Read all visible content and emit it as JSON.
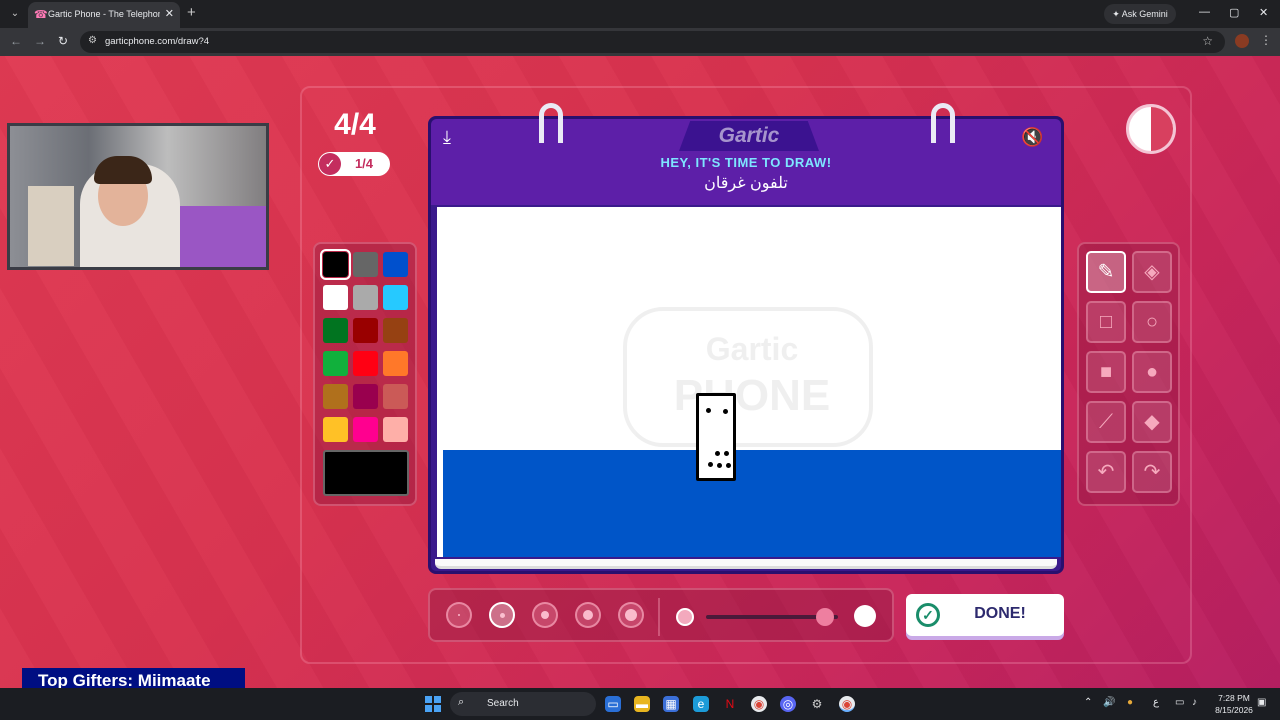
{
  "browser": {
    "tab_title": "Gartic Phone - The Telephone G",
    "tab_close": "✕",
    "new_tab": "+",
    "ask_gemini": "Ask Gemini",
    "url": "garticphone.com/draw?4"
  },
  "game": {
    "round": "4/4",
    "players_done": "1/4",
    "logo": "Gartic",
    "prompt": "HEY, IT'S TIME TO DRAW!",
    "word": "تلفون غرقان",
    "watermark_top": "Gartic",
    "watermark_bottom": "PHONE",
    "done_label": "DONE!",
    "timer_remaining_fraction": 0.5
  },
  "palette": {
    "colors": [
      "#000000",
      "#666666",
      "#0050cd",
      "#ffffff",
      "#aaaaaa",
      "#26c9ff",
      "#017420",
      "#990000",
      "#964112",
      "#11b03c",
      "#ff0013",
      "#ff7829",
      "#b0701c",
      "#99004e",
      "#cb5a57",
      "#ffc126",
      "#ff008f",
      "#feafa8"
    ],
    "selected_index": 0,
    "current_color": "#000000"
  },
  "tools": [
    {
      "name": "pen-tool",
      "icon": "✎"
    },
    {
      "name": "eraser-tool",
      "icon": "◈"
    },
    {
      "name": "rectangle-outline-tool",
      "icon": "□"
    },
    {
      "name": "ellipse-outline-tool",
      "icon": "○"
    },
    {
      "name": "rectangle-fill-tool",
      "icon": "■"
    },
    {
      "name": "ellipse-fill-tool",
      "icon": "●"
    },
    {
      "name": "line-tool",
      "icon": "⟋"
    },
    {
      "name": "bucket-tool",
      "icon": "◆"
    },
    {
      "name": "undo-tool",
      "icon": "↶"
    },
    {
      "name": "redo-tool",
      "icon": "↷"
    }
  ],
  "brush": {
    "sizes": 5,
    "selected_size_index": 1,
    "opacity_level": 0.9
  },
  "overlay": {
    "gifters": "Top Gifters: Miimaate"
  },
  "taskbar": {
    "search_label": "Search",
    "time": "7:28 PM",
    "date": "8/15/2026",
    "lang": "ع"
  }
}
